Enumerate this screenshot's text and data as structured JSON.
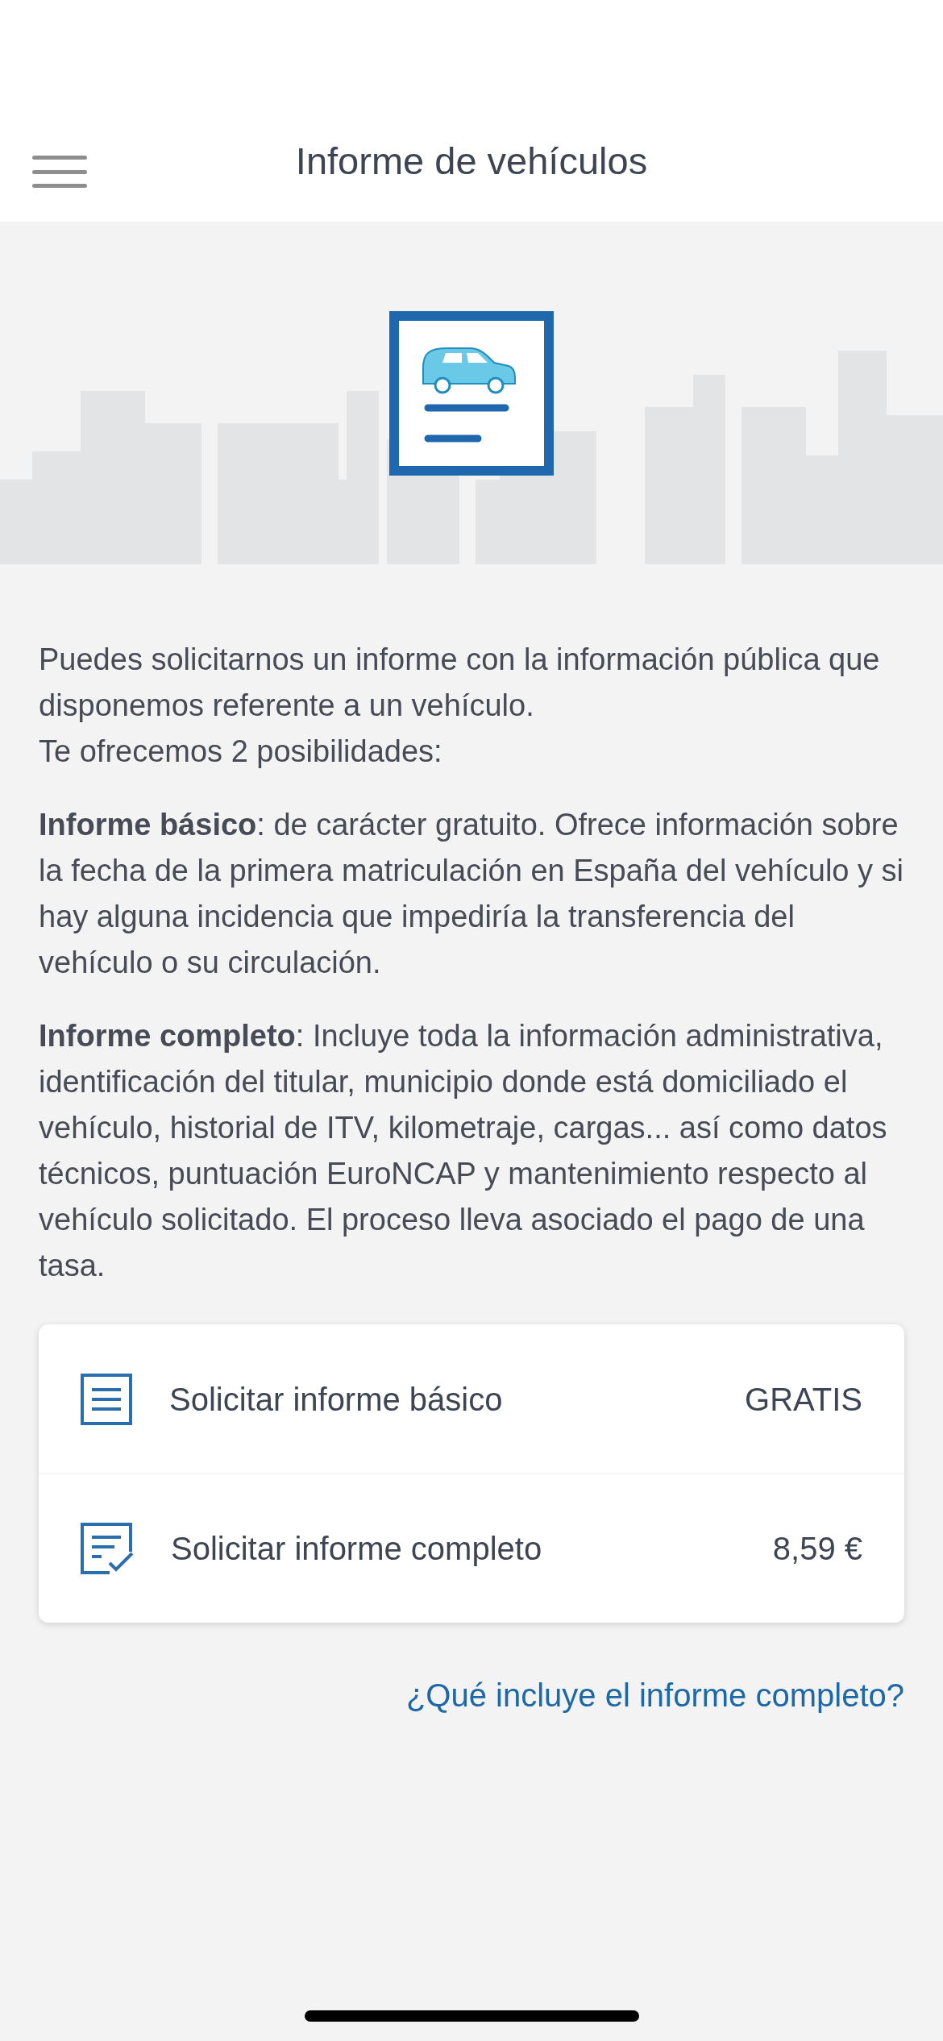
{
  "header": {
    "title": "Informe de vehículos"
  },
  "paragraphs": [
    "Puedes solicitarnos un informe con la información pública que disponemos referente a un vehículo.\nTe ofrecemos 2 posibilidades:",
    "**Informe básico**: de carácter gratuito. Ofrece información sobre la fecha de la primera matriculación en España del vehículo y si hay alguna incidencia que impediría la transferencia del vehículo o su circulación.",
    "**Informe completo**: Incluye toda la información administrativa, identificación del titular, municipio donde está domiciliado el vehículo, historial de ITV, kilometraje, cargas... así como datos técnicos, puntuación EuroNCAP y mantenimiento respecto al vehículo solicitado. El proceso lleva asociado el pago de una tasa."
  ],
  "options": [
    {
      "kind": "basic",
      "label": "Solicitar informe básico",
      "price": "GRATIS"
    },
    {
      "kind": "complete",
      "label": "Solicitar informe completo",
      "price": "8,59 €"
    }
  ],
  "link": "¿Qué incluye el informe completo?"
}
